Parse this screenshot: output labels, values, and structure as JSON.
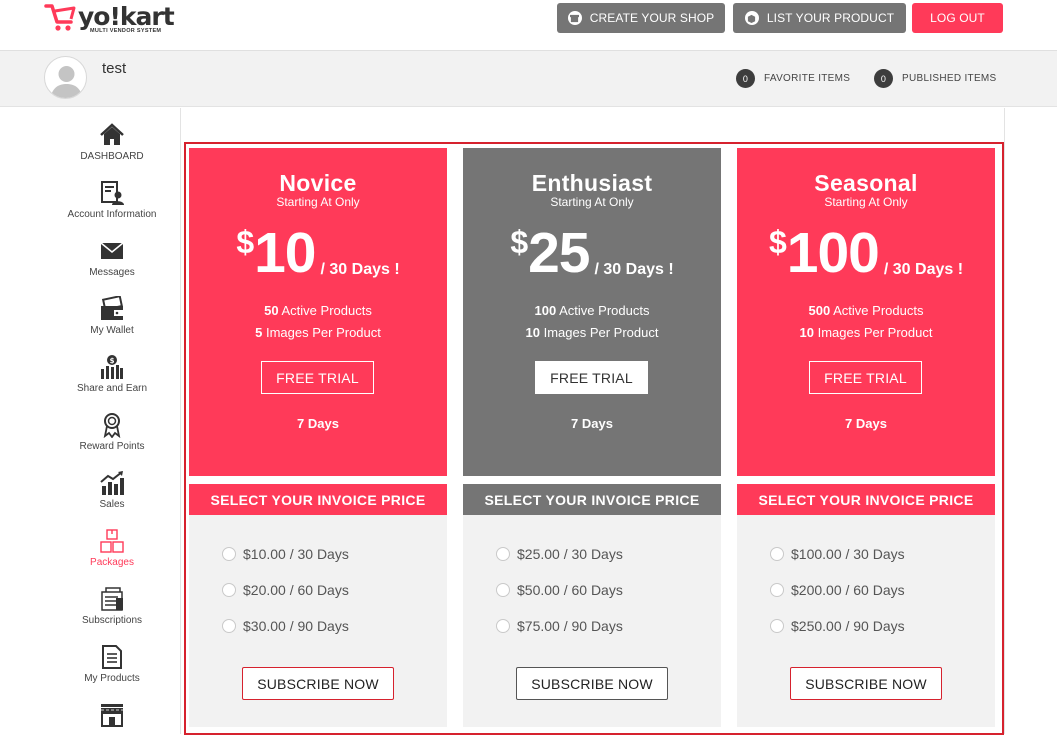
{
  "brand": {
    "name": "yo!kart",
    "tagline": "MULTI VENDOR SYSTEM",
    "accent": "#ff3a59",
    "dark": "#757575"
  },
  "header": {
    "create_shop": "CREATE YOUR SHOP",
    "list_product": "LIST YOUR PRODUCT",
    "logout": "LOG OUT"
  },
  "profile": {
    "username": "test",
    "favorite_count": "0",
    "favorite_label": "FAVORITE ITEMS",
    "published_count": "0",
    "published_label": "PUBLISHED ITEMS"
  },
  "sidebar": {
    "items": [
      {
        "label": "DASHBOARD",
        "icon": "home-icon"
      },
      {
        "label": "Account Information",
        "icon": "account-icon"
      },
      {
        "label": "Messages",
        "icon": "envelope-icon"
      },
      {
        "label": "My Wallet",
        "icon": "wallet-icon"
      },
      {
        "label": "Share and Earn",
        "icon": "share-earn-icon"
      },
      {
        "label": "Reward Points",
        "icon": "award-icon"
      },
      {
        "label": "Sales",
        "icon": "sales-chart-icon"
      },
      {
        "label": "Packages",
        "icon": "packages-icon",
        "active": true
      },
      {
        "label": "Subscriptions",
        "icon": "subscriptions-icon"
      },
      {
        "label": "My Products",
        "icon": "document-icon"
      },
      {
        "label": "",
        "icon": "shop-icon"
      }
    ]
  },
  "packages": [
    {
      "name": "Novice",
      "subtitle": "Starting At Only",
      "currency": "$",
      "price": "10",
      "period": "/ 30 Days !",
      "products_count": "50",
      "products_label": "Active Products",
      "images_count": "5",
      "images_label": "Images Per Product",
      "trial_label": "FREE TRIAL",
      "trial_days": "7 Days",
      "invoice_header": "SELECT YOUR INVOICE PRICE",
      "options": [
        "$10.00 / 30 Days",
        "$20.00 / 60 Days",
        "$30.00 / 90 Days"
      ],
      "subscribe_label": "SUBSCRIBE NOW"
    },
    {
      "name": "Enthusiast",
      "subtitle": "Starting At Only",
      "currency": "$",
      "price": "25",
      "period": "/ 30 Days !",
      "products_count": "100",
      "products_label": "Active Products",
      "images_count": "10",
      "images_label": "Images Per Product",
      "trial_label": "FREE TRIAL",
      "trial_days": "7 Days",
      "invoice_header": "SELECT YOUR INVOICE PRICE",
      "options": [
        "$25.00 / 30 Days",
        "$50.00 / 60 Days",
        "$75.00 / 90 Days"
      ],
      "subscribe_label": "SUBSCRIBE NOW"
    },
    {
      "name": "Seasonal",
      "subtitle": "Starting At Only",
      "currency": "$",
      "price": "100",
      "period": "/ 30 Days !",
      "products_count": "500",
      "products_label": "Active Products",
      "images_count": "10",
      "images_label": "Images Per Product",
      "trial_label": "FREE TRIAL",
      "trial_days": "7 Days",
      "invoice_header": "SELECT YOUR INVOICE PRICE",
      "options": [
        "$100.00 / 30 Days",
        "$200.00 / 60 Days",
        "$250.00 / 90 Days"
      ],
      "subscribe_label": "SUBSCRIBE NOW"
    }
  ]
}
